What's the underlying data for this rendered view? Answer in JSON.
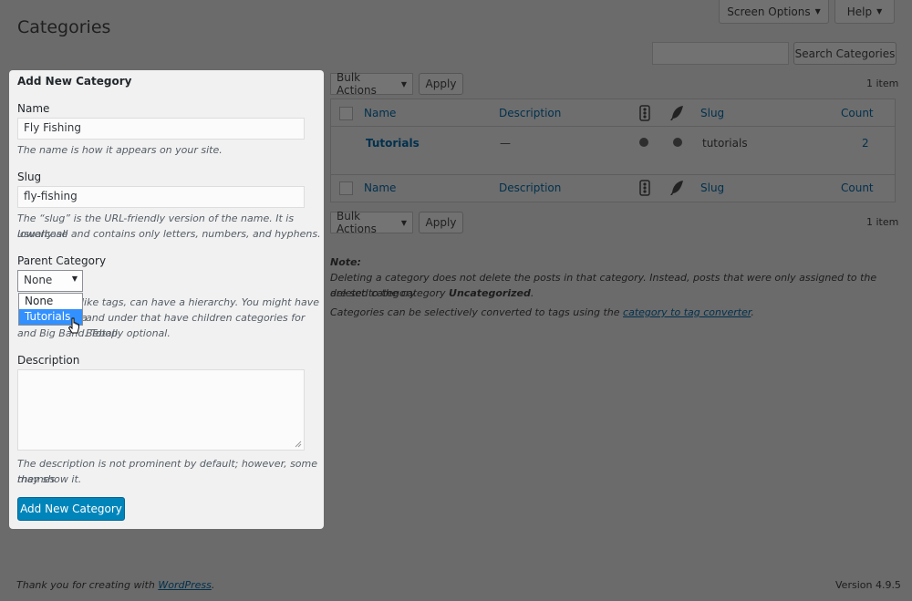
{
  "header": {
    "title": "Categories",
    "screen_options": "Screen Options",
    "help": "Help",
    "search_button": "Search Categories",
    "search_value": ""
  },
  "form": {
    "heading": "Add New Category",
    "name_label": "Name",
    "name_value": "Fly Fishing",
    "name_help": "The name is how it appears on your site.",
    "slug_label": "Slug",
    "slug_value": "fly-fishing",
    "slug_help_1": "The “slug” is the URL-friendly version of the name. It is usually all",
    "slug_help_2": "lowercase and contains only letters, numbers, and hyphens.",
    "parent_label": "Parent Category",
    "parent_selected": "None",
    "parent_options": [
      "None",
      "Tutorials"
    ],
    "parent_help_1": "like tags, can have a hierarchy. You might have a",
    "parent_help_2": "and under that have children categories for Bebop",
    "parent_help_3": "and Big Band. Totally optional.",
    "description_label": "Description",
    "description_value": "",
    "description_help_1": "The description is not prominent by default; however, some themes",
    "description_help_2": "may show it.",
    "submit": "Add New Category"
  },
  "list": {
    "bulk_actions": "Bulk Actions",
    "apply": "Apply",
    "item_count": "1 item",
    "columns": {
      "name": "Name",
      "description": "Description",
      "slug": "Slug",
      "count": "Count"
    },
    "rows": [
      {
        "name": "Tutorials",
        "description": "—",
        "slug": "tutorials",
        "count": "2"
      }
    ]
  },
  "note": {
    "title": "Note:",
    "line1": "Deleting a category does not delete the posts in that category. Instead, posts that were only assigned to the deleted category",
    "line2_pre": "are set to the category ",
    "line2_bold": "Uncategorized",
    "line2_post": ".",
    "convert_pre": "Categories can be selectively converted to tags using the ",
    "convert_link": "category to tag converter",
    "convert_post": "."
  },
  "footer": {
    "thanks_pre": "Thank you for creating with ",
    "thanks_link": "WordPress",
    "thanks_post": ".",
    "version": "Version 4.9.5"
  },
  "colors": {
    "overlay": "#6b6b6b",
    "primary": "#0085ba",
    "dropdown_highlight": "#3390ff"
  },
  "icons": [
    "chevron-down-icon",
    "traffic-light-icon",
    "feather-icon",
    "pointer-cursor-icon",
    "resize-handle-icon"
  ]
}
